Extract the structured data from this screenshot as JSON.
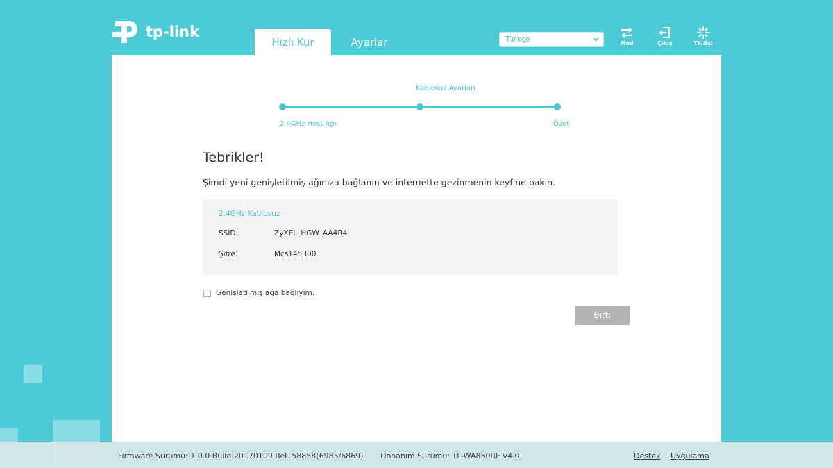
{
  "header": {
    "logo_text": "tp-link",
    "tabs": [
      {
        "label": "Hızlı Kur",
        "active": true
      },
      {
        "label": "Ayarlar",
        "active": false
      }
    ],
    "language": {
      "selected": "Türkçe"
    },
    "icons": [
      {
        "name": "mode-icon",
        "label": "Mod"
      },
      {
        "name": "logout-icon",
        "label": "Çıkış"
      },
      {
        "name": "reboot-icon",
        "label": "Tk.Bşl"
      }
    ]
  },
  "wizard": {
    "steps": [
      {
        "label": "2.4GHz Host Ağı"
      },
      {
        "label": "Kablosuz Ayarları"
      },
      {
        "label": "Özet"
      }
    ]
  },
  "content": {
    "title": "Tebrikler!",
    "subtitle": "Şimdi yeni genişletilmiş ağınıza bağlanın ve internette gezinmenin keyfine bakın.",
    "section_heading": "2.4GHz Kablosuz",
    "ssid_label": "SSID:",
    "ssid_value": "ZyXEL_HGW_AA4R4",
    "password_label": "Şifre:",
    "password_value": "Mcs145300",
    "checkbox_label": "Genişletilmiş ağa bağlıyım.",
    "checkbox_checked": false,
    "finish_button": "Bitti"
  },
  "footer": {
    "firmware": "Firmware Sürümü: 1.0.0 Build 20170109 Rel. 58858(6985/6869)",
    "hardware": "Donanım Sürümü: TL-WA850RE v4.0",
    "support_link": "Destek",
    "app_link": "Uygulama"
  },
  "colors": {
    "background": "#4ccbd7",
    "accent": "#4ac5d2",
    "button_disabled": "#b5b5b5"
  }
}
